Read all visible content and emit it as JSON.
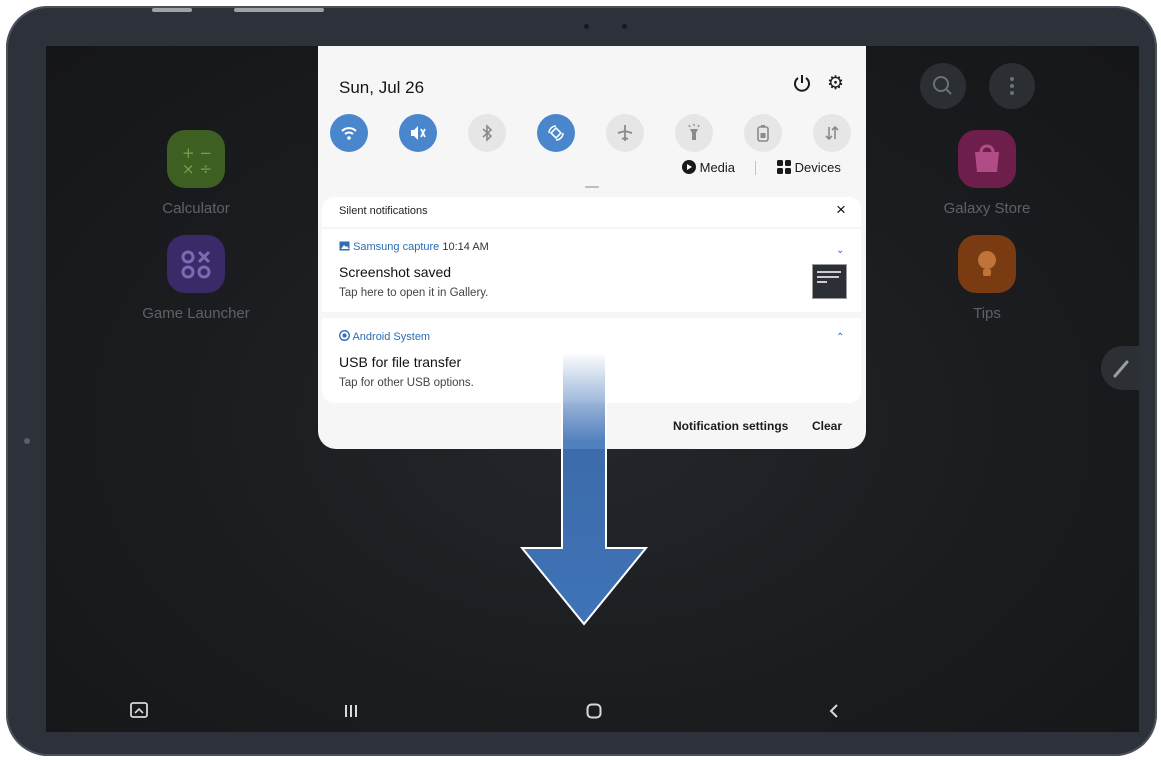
{
  "home": {
    "apps": [
      {
        "label": "Calculator",
        "icon": "calculator-icon",
        "color": "#3d5f22"
      },
      {
        "label": "Game Launcher",
        "icon": "game-launcher-icon",
        "color": "#3a2a68"
      },
      {
        "label": "Galaxy Store",
        "icon": "galaxy-store-icon",
        "color": "#6e1e4a"
      },
      {
        "label": "Tips",
        "icon": "tips-icon",
        "color": "#7a3a12"
      }
    ],
    "top_icons": [
      "search-icon",
      "more-options-icon"
    ]
  },
  "panel": {
    "date": "Sun, Jul 26",
    "quick_toggles": [
      {
        "name": "wifi",
        "active": true
      },
      {
        "name": "sound-mute",
        "active": true
      },
      {
        "name": "bluetooth",
        "active": false
      },
      {
        "name": "auto-rotate",
        "active": true
      },
      {
        "name": "airplane-mode",
        "active": false
      },
      {
        "name": "flashlight",
        "active": false
      },
      {
        "name": "power-saving",
        "active": false
      },
      {
        "name": "mobile-data",
        "active": false
      }
    ],
    "media_label": "Media",
    "devices_label": "Devices",
    "silent_header": "Silent notifications",
    "notifications": [
      {
        "app": "Samsung capture",
        "time": "10:14 AM",
        "title": "Screenshot saved",
        "text": "Tap here to open it in Gallery."
      },
      {
        "app": "Android System",
        "title": "USB for file transfer",
        "text": "Tap for other USB options."
      }
    ],
    "settings_label": "Notification settings",
    "clear_label": "Clear"
  },
  "colors": {
    "accent": "#4a86cc",
    "arrow": "#3f73b8"
  }
}
